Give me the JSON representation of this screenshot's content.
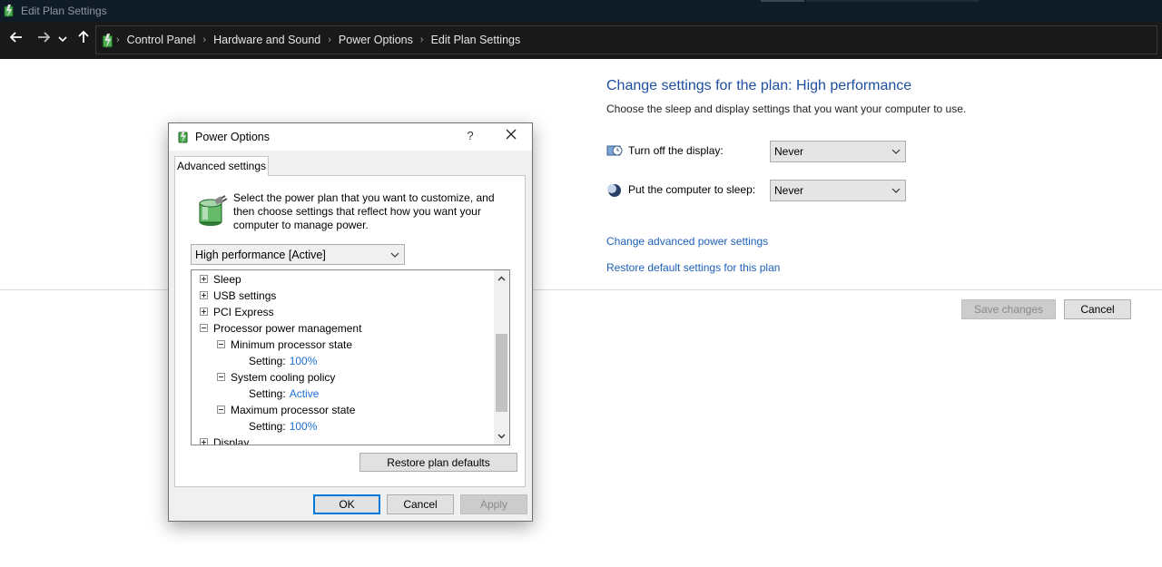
{
  "window": {
    "title": "Edit Plan Settings"
  },
  "breadcrumb": [
    "Control Panel",
    "Hardware and Sound",
    "Power Options",
    "Edit Plan Settings"
  ],
  "main": {
    "heading": "Change settings for the plan: High performance",
    "subheading": "Choose the sleep and display settings that you want your computer to use.",
    "display_label": "Turn off the display:",
    "display_value": "Never",
    "sleep_label": "Put the computer to sleep:",
    "sleep_value": "Never",
    "advanced_link": "Change advanced power settings",
    "restore_link": "Restore default settings for this plan",
    "save_button": "Save changes",
    "cancel_button": "Cancel"
  },
  "dialog": {
    "title": "Power Options",
    "help": "?",
    "tab": "Advanced settings",
    "intro": "Select the power plan that you want to customize, and then choose settings that reflect how you want your computer to manage power.",
    "plan": "High performance [Active]",
    "tree": {
      "sleep": "Sleep",
      "usb": "USB settings",
      "pci": "PCI Express",
      "processor": "Processor power management",
      "min_state": "Minimum processor state",
      "min_setting_label": "Setting:",
      "min_setting_value": "100%",
      "cooling": "System cooling policy",
      "cooling_setting_label": "Setting:",
      "cooling_setting_value": "Active",
      "max_state": "Maximum processor state",
      "max_setting_label": "Setting:",
      "max_setting_value": "100%",
      "display": "Display"
    },
    "restore_button": "Restore plan defaults",
    "ok_button": "OK",
    "cancel_button": "Cancel",
    "apply_button": "Apply"
  },
  "colors": {
    "link": "#1c5fb8",
    "heading": "#1e4fa0",
    "setting_value": "#1c6fd1",
    "focus": "#0078d7"
  }
}
